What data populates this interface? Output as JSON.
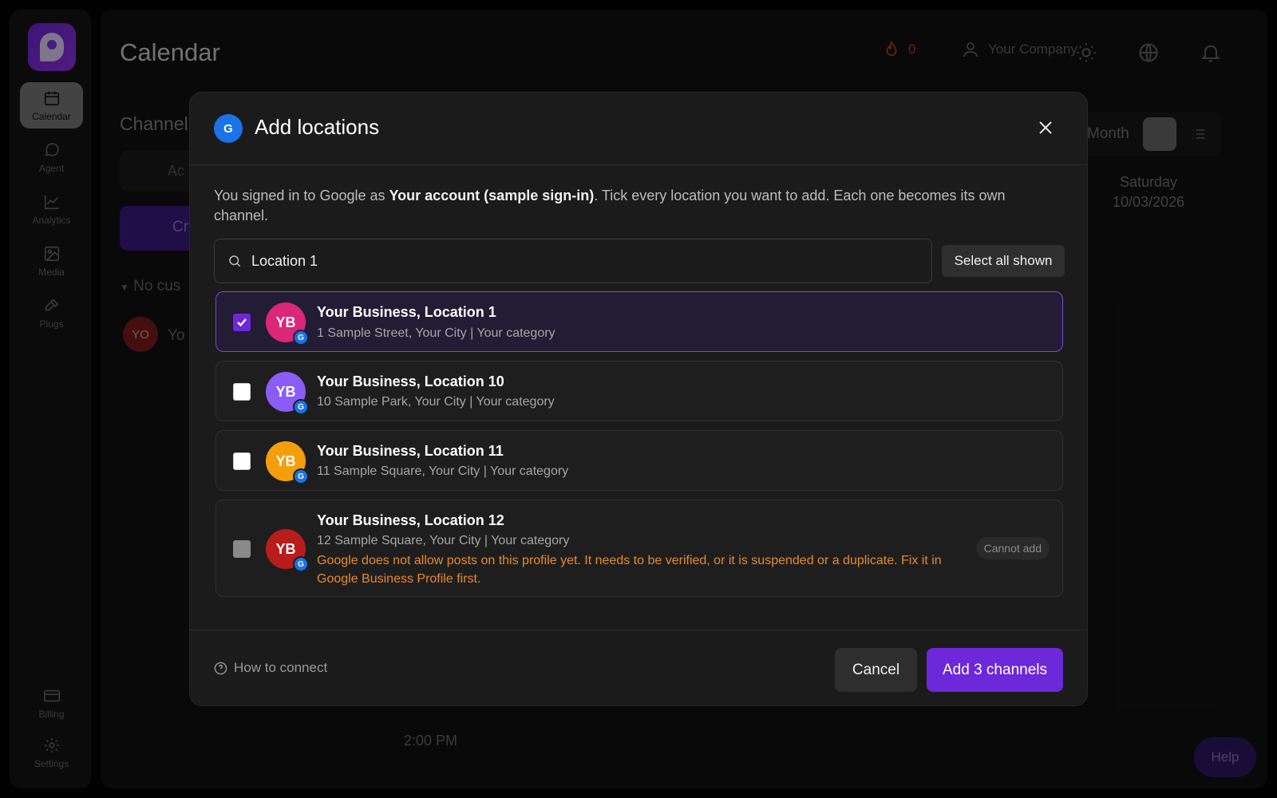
{
  "app": {
    "page_title": "Calendar",
    "streak_count": "0",
    "company_name": "Your Company",
    "sidebar": [
      {
        "label": "Calendar",
        "icon": "calendar-icon"
      },
      {
        "label": "Agent",
        "icon": "chat-icon"
      },
      {
        "label": "Analytics",
        "icon": "chart-icon"
      },
      {
        "label": "Media",
        "icon": "image-icon"
      },
      {
        "label": "Plugs",
        "icon": "plug-icon"
      },
      {
        "label": "Billing",
        "icon": "card-icon"
      },
      {
        "label": "Settings",
        "icon": "gear-icon"
      }
    ],
    "channels_title": "Channel",
    "add_channel_label": "Ac",
    "create_label": "Cr",
    "no_customer_label": "No cus",
    "channel_avatar_initials": "YO",
    "channel_name_fragment": "Yo",
    "view_month_label": "Month",
    "saturday_label": "Saturday",
    "saturday_date": "10/03/2026",
    "time_label": "2:00 PM",
    "help_label": "Help"
  },
  "modal": {
    "badge_letter": "G",
    "title": "Add locations",
    "intro_before": "You signed in to Google as ",
    "intro_account": "Your account (sample sign-in)",
    "intro_after": ". Tick every location you want to add. Each one becomes its own channel.",
    "search_value": "Location 1",
    "select_all_label": "Select all shown",
    "locations": [
      {
        "initials": "YB",
        "name": "Your Business, Location 1",
        "address": "1 Sample Street, Your City | Your category",
        "checked": true,
        "color": "#db2777"
      },
      {
        "initials": "YB",
        "name": "Your Business, Location 10",
        "address": "10 Sample Park, Your City | Your category",
        "checked": false,
        "color": "#8b5cf6"
      },
      {
        "initials": "YB",
        "name": "Your Business, Location 11",
        "address": "11 Sample Square, Your City | Your category",
        "checked": false,
        "color": "#f59e0b"
      },
      {
        "initials": "YB",
        "name": "Your Business, Location 12",
        "address": "12 Sample Square, Your City | Your category",
        "checked": false,
        "color": "#b91c1c",
        "disabled": true,
        "warning": "Google does not allow posts on this profile yet. It needs to be verified, or it is suspended or a duplicate. Fix it in Google Business Profile first.",
        "status": "Cannot add"
      }
    ],
    "how_to_connect": "How to connect",
    "cancel_label": "Cancel",
    "add_label": "Add 3 channels"
  },
  "colors": {
    "accent": "#6d28d9",
    "google_blue": "#1a73e8",
    "warning": "#e68a2e"
  }
}
